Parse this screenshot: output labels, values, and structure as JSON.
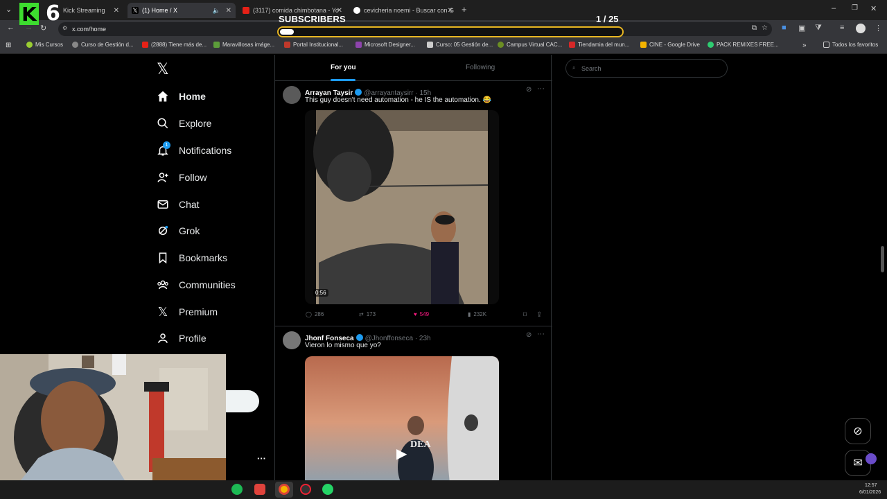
{
  "browser": {
    "tabs": [
      {
        "title": "Kick Streaming",
        "active": false
      },
      {
        "title": "(1) Home / X",
        "active": true
      },
      {
        "title": "(3117) comida chimbotana - Yo",
        "active": false
      },
      {
        "title": "cevicheria noemi - Buscar con G",
        "active": false
      }
    ],
    "url": "x.com/home",
    "bookmarks": [
      "Mis Cursos",
      "Curso de Gestión d...",
      "(2888) Tiene más de...",
      "Maravillosas imáge...",
      "Portal Institucional...",
      "Microsoft Designer...",
      "Curso: 05 Gestión de...",
      "Campus Virtual CAC...",
      "Tiendamia del mun...",
      "CINE - Google Drive",
      "PACK REMIXES FREE...",
      "Todos los favoritos"
    ]
  },
  "overlay": {
    "label": "SUBSCRIBERS",
    "count": "1  / 25",
    "progress": 0.04,
    "logo_letter": "K",
    "logo_number": "6"
  },
  "nav": {
    "items": [
      "Home",
      "Explore",
      "Notifications",
      "Follow",
      "Chat",
      "Grok",
      "Bookmarks",
      "Communities",
      "Premium",
      "Profile"
    ],
    "notification_badge": "1",
    "more": "···"
  },
  "timeline": {
    "tabs": [
      "For you",
      "Following"
    ],
    "posts": [
      {
        "name": "Arrayan Taysir",
        "handle": "@arrayantaysirr · 15h",
        "text": "This guy doesn't need automation - he IS the automation. 😂",
        "duration": "0:56",
        "replies": "286",
        "reposts": "173",
        "likes": "549",
        "views": "232K"
      },
      {
        "name": "Jhonf Fonseca",
        "handle": "@Jhonffonseca · 23h",
        "text": "Vieron lo mismo que yo?",
        "image_text": "DEA"
      }
    ]
  },
  "search": {
    "placeholder": "Search"
  },
  "clock": {
    "time": "12:57",
    "date": "6/01/2026"
  },
  "colors": {
    "accent": "#1d9bf0",
    "like": "#f91880",
    "overlay_border": "#e8b622",
    "kick_green": "#3ddc2f"
  }
}
